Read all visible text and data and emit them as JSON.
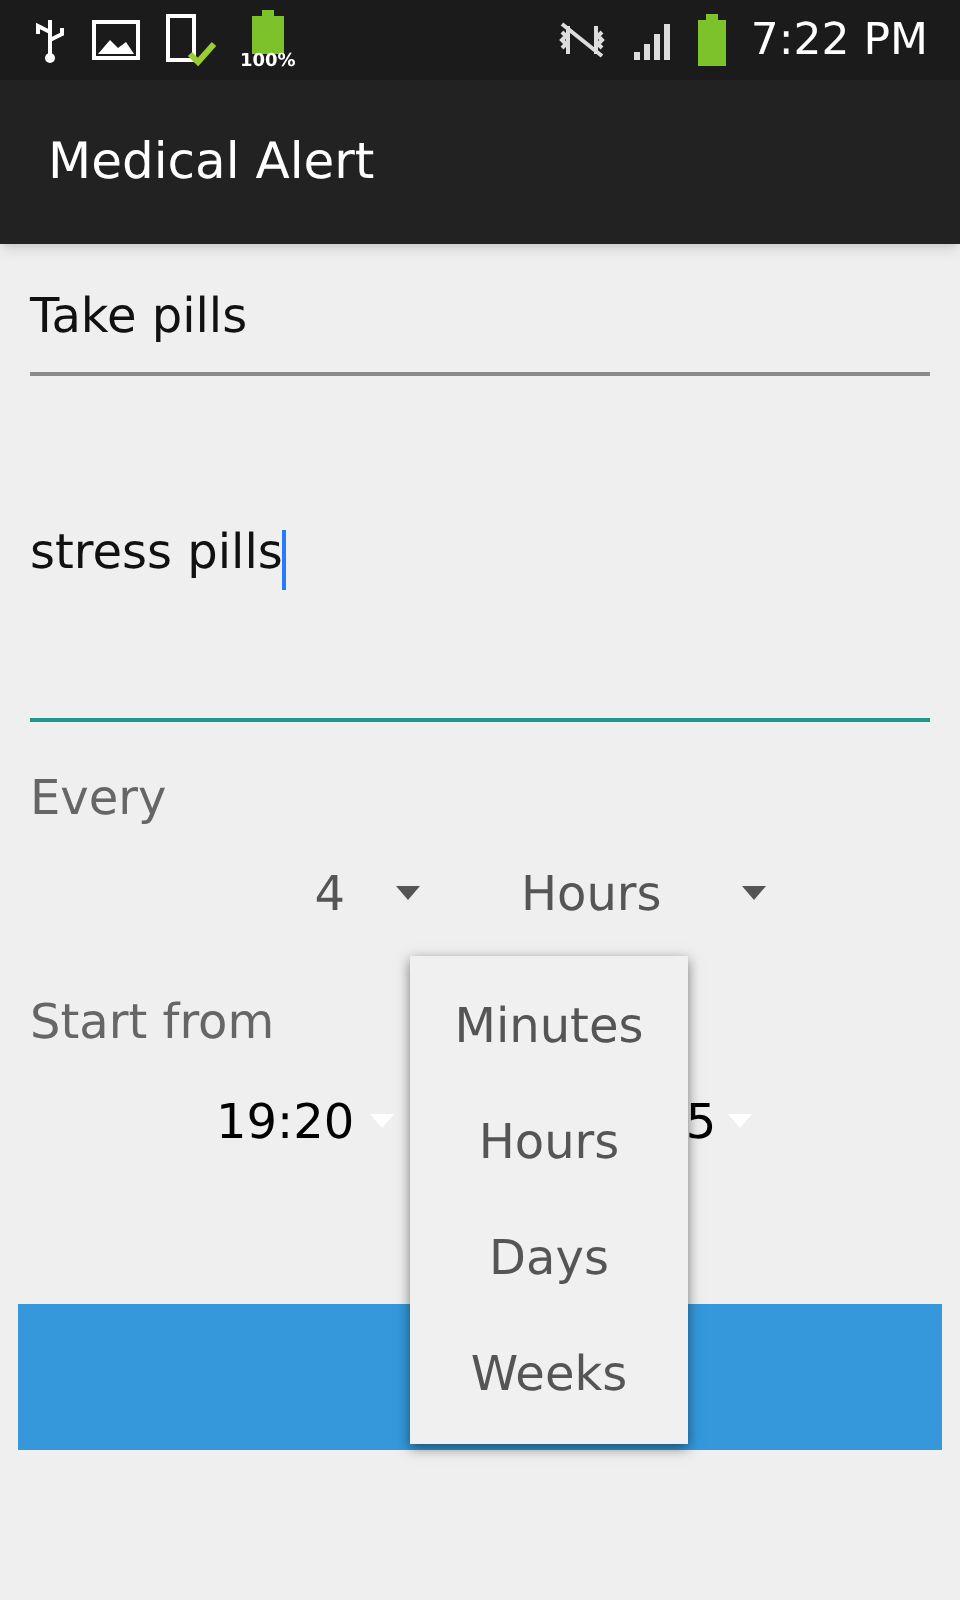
{
  "status_bar": {
    "battery_label": "100%",
    "time": "7:22 PM"
  },
  "action_bar": {
    "title": "Medical Alert"
  },
  "fields": [
    {
      "value": "Take pills",
      "focused": false
    },
    {
      "value": "stress pills",
      "focused": true
    }
  ],
  "every": {
    "label": "Every",
    "count": "4",
    "unit": "Hours"
  },
  "start": {
    "label": "Start from",
    "time": "19:20",
    "date_end": "5"
  },
  "dropdown": {
    "options": [
      "Minutes",
      "Hours",
      "Days",
      "Weeks"
    ]
  }
}
